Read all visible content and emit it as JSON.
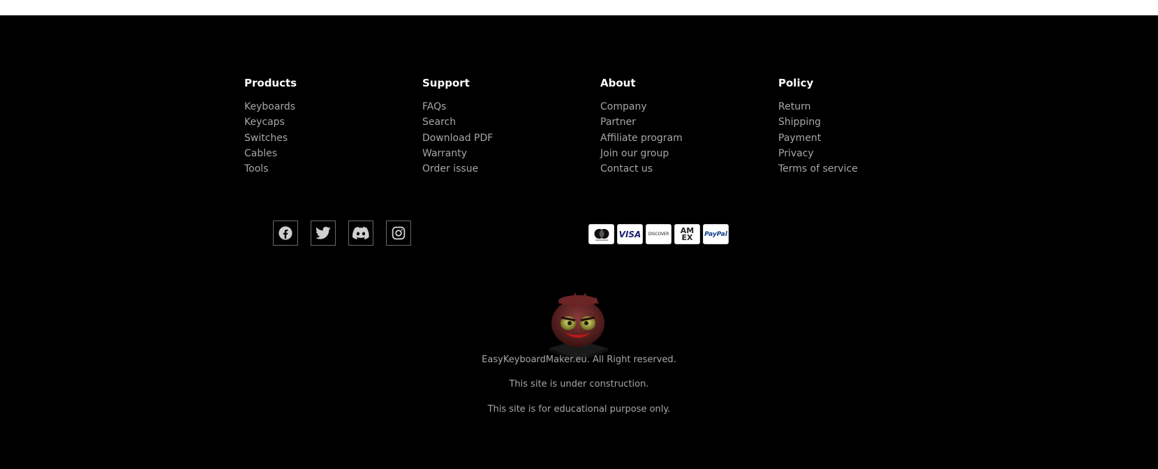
{
  "columns": [
    {
      "title": "Products",
      "links": [
        "Keyboards",
        "Keycaps",
        "Switches",
        "Cables",
        "Tools"
      ]
    },
    {
      "title": "Support",
      "links": [
        "FAQs",
        "Search",
        "Download PDF",
        "Warranty",
        "Order issue"
      ]
    },
    {
      "title": "About",
      "links": [
        "Company",
        "Partner",
        "Affiliate program",
        "Join our group",
        "Contact us"
      ]
    },
    {
      "title": "Policy",
      "links": [
        "Return",
        "Shipping",
        "Payment",
        "Privacy",
        "Terms of service"
      ]
    }
  ],
  "socials": [
    "facebook-icon",
    "twitter-icon",
    "discord-icon",
    "instagram-icon"
  ],
  "payments": {
    "mastercard": "mastercard",
    "visa": "VISA",
    "discover": "DISCOVER",
    "amex": "AM EX",
    "paypal": "PayPal"
  },
  "legal": {
    "copyright": "EasyKeyboardMaker.eu. All Right reserved.",
    "construction": "This site is under construction.",
    "educational": "This site is for educational purpose only."
  },
  "colors": {
    "background": "#000000",
    "heading": "#ffffff",
    "link": "#a7a7a7"
  }
}
